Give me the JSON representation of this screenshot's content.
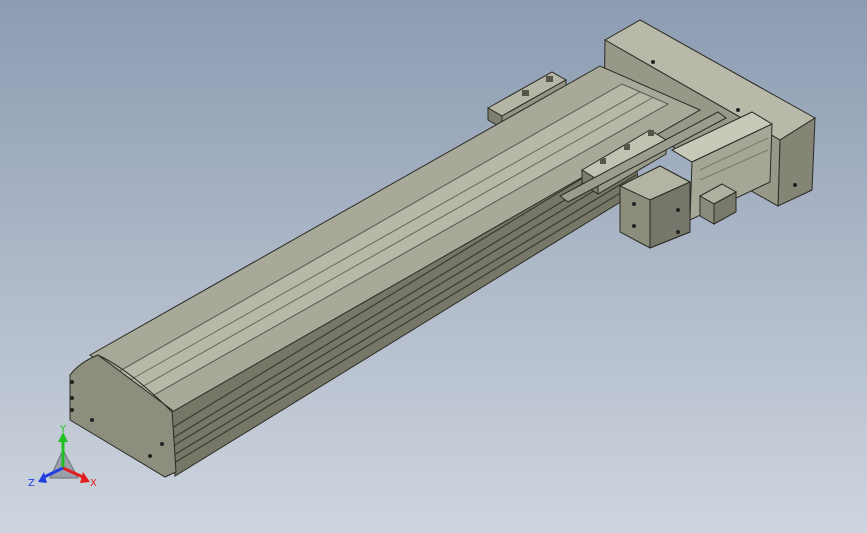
{
  "viewport": {
    "background_top": "#8c9cb2",
    "background_bottom": "#ced5de"
  },
  "model": {
    "body_color": "#a7a797",
    "face_color": "#888878",
    "edge_color": "#2a2a22",
    "motor_color": "#bdbdad"
  },
  "triad": {
    "x_label": "X",
    "y_label": "Y",
    "z_label": "Z",
    "x_color": "#e02020",
    "y_color": "#20c020",
    "z_color": "#2040e0"
  }
}
